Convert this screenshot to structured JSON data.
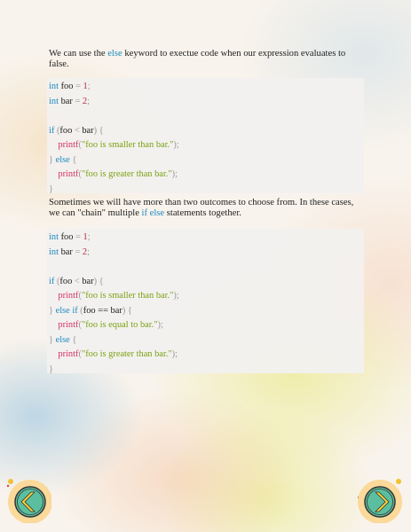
{
  "paragraph1": {
    "pre": "We can use the ",
    "kw": "else",
    "post": " keyword to exectue code when our expression evaluates to false."
  },
  "code1": [
    [
      [
        "type",
        "int"
      ],
      [
        "id",
        " foo "
      ],
      [
        "punc",
        "="
      ],
      [
        "num",
        " 1"
      ],
      [
        "punc",
        ";"
      ]
    ],
    [
      [
        "type",
        "int"
      ],
      [
        "id",
        " bar "
      ],
      [
        "punc",
        "="
      ],
      [
        "num",
        " 2"
      ],
      [
        "punc",
        ";"
      ]
    ],
    [],
    [
      [
        "kw",
        "if"
      ],
      [
        "punc",
        " ("
      ],
      [
        "id",
        "foo "
      ],
      [
        "punc",
        "<"
      ],
      [
        "id",
        " bar"
      ],
      [
        "punc",
        ") {"
      ]
    ],
    [
      [
        "id",
        "    "
      ],
      [
        "fn",
        "printf"
      ],
      [
        "punc",
        "("
      ],
      [
        "str",
        "\"foo is smaller than bar.\""
      ],
      [
        "punc",
        ");"
      ]
    ],
    [
      [
        "punc",
        "} "
      ],
      [
        "kw",
        "else"
      ],
      [
        "punc",
        " {"
      ]
    ],
    [
      [
        "id",
        "    "
      ],
      [
        "fn",
        "printf"
      ],
      [
        "punc",
        "("
      ],
      [
        "str",
        "\"foo is greater than bar.\""
      ],
      [
        "punc",
        ");"
      ]
    ],
    [
      [
        "punc",
        "}"
      ]
    ]
  ],
  "paragraph2": {
    "pre": "Sometimes we will have more than two outcomes to choose from. In these cases, we can \"chain\" multiple ",
    "kw": "if else",
    "post": " statements together."
  },
  "code2": [
    [
      [
        "type",
        "int"
      ],
      [
        "id",
        " foo "
      ],
      [
        "punc",
        "="
      ],
      [
        "num",
        " 1"
      ],
      [
        "punc",
        ";"
      ]
    ],
    [
      [
        "type",
        "int"
      ],
      [
        "id",
        " bar "
      ],
      [
        "punc",
        "="
      ],
      [
        "num",
        " 2"
      ],
      [
        "punc",
        ";"
      ]
    ],
    [],
    [
      [
        "kw",
        "if"
      ],
      [
        "punc",
        " ("
      ],
      [
        "id",
        "foo "
      ],
      [
        "punc",
        "<"
      ],
      [
        "id",
        " bar"
      ],
      [
        "punc",
        ") {"
      ]
    ],
    [
      [
        "id",
        "    "
      ],
      [
        "fn",
        "printf"
      ],
      [
        "punc",
        "("
      ],
      [
        "str",
        "\"foo is smaller than bar.\""
      ],
      [
        "punc",
        ");"
      ]
    ],
    [
      [
        "punc",
        "} "
      ],
      [
        "kw",
        "else if"
      ],
      [
        "punc",
        " ("
      ],
      [
        "id",
        "foo == bar"
      ],
      [
        "punc",
        ") {"
      ]
    ],
    [
      [
        "id",
        "    "
      ],
      [
        "fn",
        "printf"
      ],
      [
        "punc",
        "("
      ],
      [
        "str",
        "\"foo is equal to bar.\""
      ],
      [
        "punc",
        ");"
      ]
    ],
    [
      [
        "punc",
        "} "
      ],
      [
        "kw",
        "else"
      ],
      [
        "punc",
        " {"
      ]
    ],
    [
      [
        "id",
        "    "
      ],
      [
        "fn",
        "printf"
      ],
      [
        "punc",
        "("
      ],
      [
        "str",
        "\"foo is greater than bar.\""
      ],
      [
        "punc",
        ");"
      ]
    ],
    [
      [
        "punc",
        "}"
      ]
    ]
  ],
  "nav": {
    "prev_icon": "chevron-left-icon",
    "next_icon": "chevron-right-icon"
  }
}
